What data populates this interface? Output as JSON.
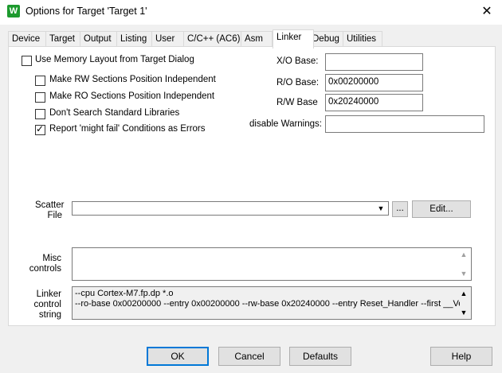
{
  "window": {
    "title": "Options for Target 'Target 1'",
    "app_icon": "W",
    "close_glyph": "✕"
  },
  "tabs": [
    {
      "label": "Device"
    },
    {
      "label": "Target"
    },
    {
      "label": "Output"
    },
    {
      "label": "Listing"
    },
    {
      "label": "User"
    },
    {
      "label": "C/C++ (AC6)"
    },
    {
      "label": "Asm"
    },
    {
      "label": "Linker",
      "active": true
    },
    {
      "label": "Debug"
    },
    {
      "label": "Utilities"
    }
  ],
  "options": {
    "use_memory_layout": {
      "label": "Use Memory Layout from Target Dialog",
      "checked": false
    },
    "rw_independent": {
      "label": "Make RW Sections Position Independent",
      "checked": false
    },
    "ro_independent": {
      "label": "Make RO Sections Position Independent",
      "checked": false
    },
    "dont_search_libs": {
      "label": "Don't Search Standard Libraries",
      "checked": false
    },
    "might_fail_errors": {
      "label": "Report 'might fail' Conditions as Errors",
      "checked": true
    }
  },
  "bases": {
    "xo_label": "X/O Base:",
    "xo_value": "",
    "ro_label": "R/O Base:",
    "ro_value": "0x00200000",
    "rw_label": "R/W Base",
    "rw_value": "0x20240000",
    "warnings_label": "disable Warnings:",
    "warnings_value": ""
  },
  "scatter": {
    "label_line1": "Scatter",
    "label_line2": "File",
    "value": "",
    "browse_label": "...",
    "edit_label": "Edit..."
  },
  "misc": {
    "label_line1": "Misc",
    "label_line2": "controls",
    "value": ""
  },
  "linker": {
    "label_line1": "Linker",
    "label_line2": "control",
    "label_line3": "string",
    "line1": "--cpu Cortex-M7.fp.dp *.o",
    "line2": "--ro-base 0x00200000 --entry 0x00200000 --rw-base 0x20240000 --entry Reset_Handler --first __Vector"
  },
  "footer": {
    "ok": "OK",
    "cancel": "Cancel",
    "defaults": "Defaults",
    "help": "Help"
  }
}
